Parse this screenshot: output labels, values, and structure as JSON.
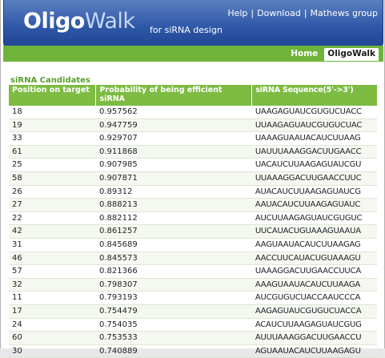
{
  "header": {
    "logo_part1": "Oligo",
    "logo_part2": "Walk",
    "tagline": "for siRNA design",
    "links": [
      "Help",
      "Download",
      "Mathews group"
    ]
  },
  "nav": {
    "tabs": [
      "Home",
      "OligoWalk"
    ],
    "active": "OligoWalk"
  },
  "section_title": "siRNA Candidates",
  "table": {
    "headers": [
      "Position on target",
      "Probability of being efficient siRNA",
      "siRNA Sequence(5'->3')"
    ],
    "rows": [
      [
        "18",
        "0.957562",
        "UAAGAGUAUCGUGUCUACC"
      ],
      [
        "19",
        "0.947759",
        "UUAAGAGUAUCGUGUCUAC"
      ],
      [
        "33",
        "0.929707",
        "UAAAGUAAUACAUCUUAAG"
      ],
      [
        "61",
        "0.911868",
        "UAUUUAAAGGACUUGAACC"
      ],
      [
        "25",
        "0.907985",
        "UACAUCUUAAGAGUAUCGU"
      ],
      [
        "58",
        "0.907871",
        "UUAAAGGACUUGAACCUUC"
      ],
      [
        "26",
        "0.89312",
        "AUACAUCUUAAGAGUAUCG"
      ],
      [
        "27",
        "0.888213",
        "AAUACAUCUUAAGAGUAUC"
      ],
      [
        "22",
        "0.882112",
        "AUCUUAAGAGUAUCGUGUC"
      ],
      [
        "42",
        "0.861257",
        "UUCAUACUGUAAAGUAAUA"
      ],
      [
        "31",
        "0.845689",
        "AAGUAAUACAUCUUAAGAG"
      ],
      [
        "46",
        "0.845573",
        "AACCUUCAUACUGUAAAGU"
      ],
      [
        "57",
        "0.821366",
        "UAAAGGACUUGAACCUUCA"
      ],
      [
        "32",
        "0.798307",
        "AAAGUAAUACAUCUUAAGA"
      ],
      [
        "11",
        "0.793193",
        "AUCGUGUCUACCAAUCCCA"
      ],
      [
        "17",
        "0.754479",
        "AAGAGUAUCGUGUCUACCA"
      ],
      [
        "24",
        "0.754035",
        "ACAUCUUAAGAGUAUCGUG"
      ],
      [
        "60",
        "0.753533",
        "AUUUAAAGGACUUGAACCU"
      ],
      [
        "30",
        "0.740889",
        "AGUAAUACAUCUUAAGAGU"
      ]
    ]
  },
  "colors": {
    "header_blue": "#2f58a8",
    "nav_green": "#6fb33b",
    "table_header_green": "#7dbb43",
    "section_title_green": "#5aa02c"
  }
}
